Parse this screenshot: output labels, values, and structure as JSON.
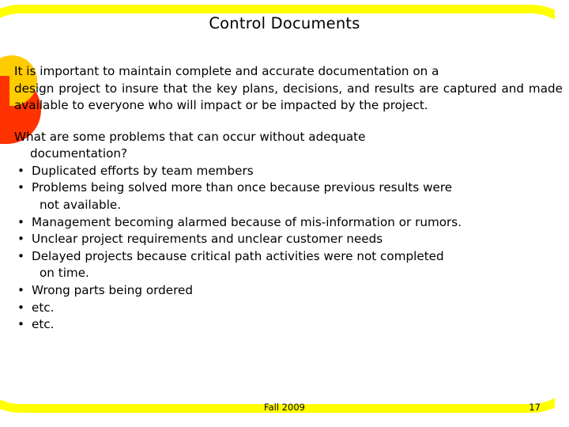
{
  "slide": {
    "title": "Control Documents",
    "paragraph1": {
      "line1": "It is important to maintain complete and accurate documentation on  a",
      "rest": "design project to insure that the key plans, decisions,  and results are captured and made available to everyone who will impact or be impacted by the project."
    },
    "paragraph2": {
      "line1": "What are some problems that can occur without adequate",
      "line2": "documentation?"
    },
    "bullets": [
      {
        "marker": "•",
        "text": "Duplicated efforts by team members",
        "continuation": ""
      },
      {
        "marker": "•",
        "text": "Problems being solved more than once because previous results were",
        "continuation": "not available."
      },
      {
        "marker": "•",
        "text": "Management becoming alarmed because of mis-information or rumors.",
        "continuation": ""
      },
      {
        "marker": "•",
        "text": "Unclear project requirements and unclear customer needs",
        "continuation": ""
      },
      {
        "marker": "•",
        "text": "Delayed projects because critical path activities were not completed",
        "continuation": "on time."
      },
      {
        "marker": "•",
        "text": "Wrong parts being ordered",
        "continuation": ""
      },
      {
        "marker": "•",
        "text": "etc.",
        "continuation": ""
      },
      {
        "marker": "•",
        "text": " etc.",
        "continuation": ""
      }
    ],
    "footer": {
      "date": "Fall 2009",
      "page_number": "17"
    },
    "colors": {
      "frame": "#ffff00",
      "circle_outer": "#ff3300",
      "circle_inner": "#ffcc00",
      "text": "#000000",
      "background": "#ffffff"
    }
  }
}
